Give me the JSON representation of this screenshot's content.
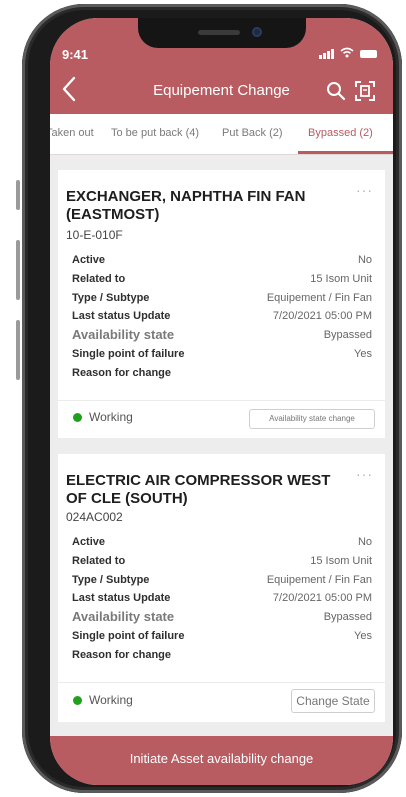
{
  "status_bar": {
    "time": "9:41"
  },
  "header": {
    "title": "Equipement Change"
  },
  "tabs": [
    {
      "label": "Taken out"
    },
    {
      "label": "To be put back (4)"
    },
    {
      "label": "Put Back (2)"
    },
    {
      "label": "Bypassed (2)"
    }
  ],
  "active_tab": "Bypassed (2)",
  "cards": [
    {
      "name": "EXCHANGER, NAPHTHA FIN FAN (EASTMOST)",
      "code": "10-E-010F",
      "more": "···",
      "fields": [
        {
          "label": "Active",
          "value": "No"
        },
        {
          "label": "Related to",
          "value": "15 Isom Unit"
        },
        {
          "label": "Type / Subtype",
          "value": "Equipement / Fin Fan"
        },
        {
          "label": "Last status Update",
          "value": "7/20/2021 05:00 PM"
        },
        {
          "label": "Availability state",
          "value": "Bypassed"
        },
        {
          "label": "Single point of failure",
          "value": "Yes"
        },
        {
          "label": "Reason for change",
          "value": ""
        }
      ],
      "status": "Working",
      "action_label": "Availability state change"
    },
    {
      "name": "ELECTRIC AIR COMPRESSOR WEST OF CLE (SOUTH)",
      "code": "024AC002",
      "more": "···",
      "fields": [
        {
          "label": "Active",
          "value": "No"
        },
        {
          "label": "Related to",
          "value": "15 Isom Unit"
        },
        {
          "label": "Type / Subtype",
          "value": "Equipement / Fin Fan"
        },
        {
          "label": "Last status Update",
          "value": "7/20/2021 05:00 PM"
        },
        {
          "label": "Availability state",
          "value": "Bypassed"
        },
        {
          "label": "Single point of failure",
          "value": "Yes"
        },
        {
          "label": "Reason for change",
          "value": ""
        }
      ],
      "status": "Working",
      "action_label": "Change State"
    }
  ],
  "bottom_action": {
    "label": "Initiate Asset availability change"
  },
  "colors": {
    "brand": "#b85c61",
    "status_working": "#21a01e",
    "background": "#eeeded"
  },
  "icons": {
    "back": "chevron-left-icon",
    "search": "search-icon",
    "scan": "scan-icon",
    "more": "more-horizontal-icon",
    "signal": "signal-icon",
    "wifi": "wifi-icon",
    "battery": "battery-icon"
  }
}
